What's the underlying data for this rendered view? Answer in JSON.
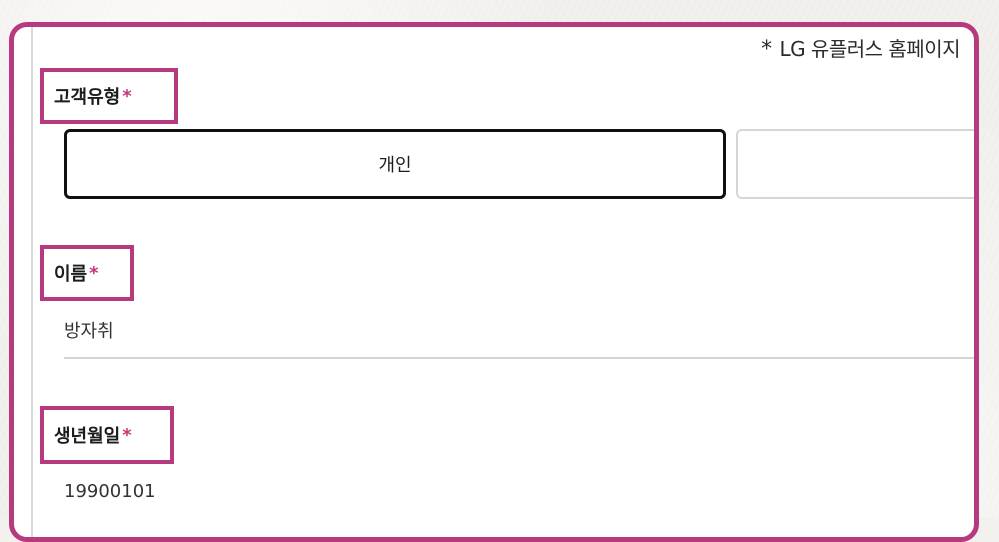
{
  "notice": {
    "star": "*",
    "text": "LG 유플러스 홈페이지"
  },
  "customer_type": {
    "label": "고객유형",
    "required_mark": "*",
    "options": [
      {
        "label": "개인",
        "selected": true
      },
      {
        "label": "",
        "selected": false
      }
    ]
  },
  "name": {
    "label": "이름",
    "required_mark": "*",
    "value": "방자취"
  },
  "birth": {
    "label": "생년월일",
    "required_mark": "*",
    "value": "19900101"
  },
  "colors": {
    "highlight": "#b83a7e",
    "required": "#c8347a"
  }
}
